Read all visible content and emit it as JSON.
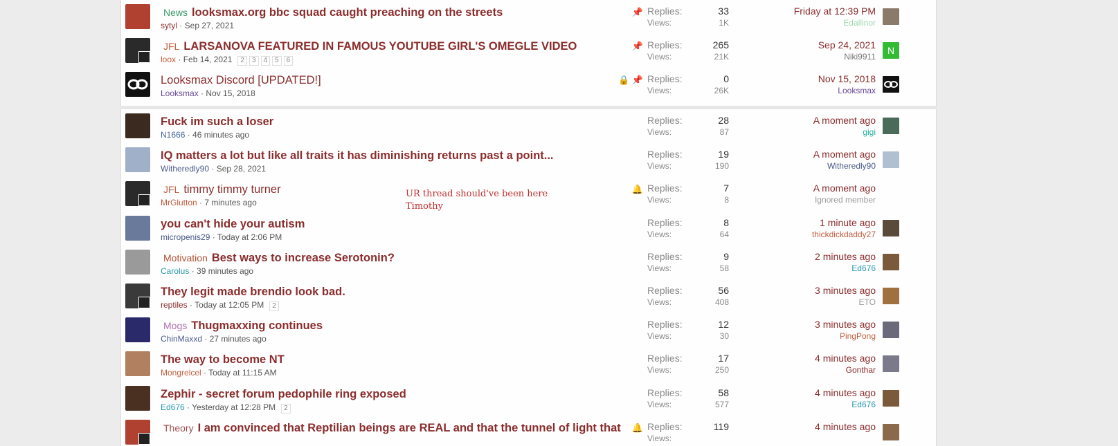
{
  "colors": {
    "title": "#8b2d2d",
    "background": "#ececec",
    "panel": "#fefefe"
  },
  "sticky_threads": [
    {
      "prefix": "News",
      "prefix_class": "p-news",
      "title": "looksmax.org bbc squad caught preaching on the streets",
      "author": "sytyl",
      "author_color": "#8b2d2d",
      "date": "Sep 27, 2021",
      "pages": [],
      "icons": "📌",
      "replies": "33",
      "views": "1K",
      "last_time": "Friday at 12:39 PM",
      "last_user": "Edallinor",
      "last_user_color": "#9fd9b0",
      "avatar_color": "#b04030",
      "avatar_mini": false,
      "last_avatar_color": "#8a7a6a"
    },
    {
      "prefix": "JFL",
      "prefix_class": "p-jfl",
      "title": "LARSANOVA FEATURED IN FAMOUS YOUTUBE GIRL'S OMEGLE VIDEO",
      "author": "loox",
      "author_color": "#c06040",
      "date": "Feb 14, 2021",
      "pages": [
        "2",
        "3",
        "4",
        "5",
        "6"
      ],
      "icons": "📌",
      "replies": "265",
      "views": "21K",
      "last_time": "Sep 24, 2021",
      "last_user": "Niki9911",
      "last_user_color": "#777777",
      "avatar_color": "#2a2a2a",
      "avatar_mini": true,
      "last_avatar_color": "#33bb33",
      "last_avatar_letter": "N"
    },
    {
      "prefix": "",
      "prefix_class": "",
      "title": "Looksmax Discord [UPDATED!]",
      "light": true,
      "author": "Looksmax",
      "author_color": "#6a4a9a",
      "date": "Nov 15, 2018",
      "pages": [],
      "icons": "🔒 📌",
      "replies": "0",
      "views": "26K",
      "last_time": "Nov 15, 2018",
      "last_user": "Looksmax",
      "last_user_color": "#6a4a9a",
      "avatar_color": "#111111",
      "avatar_mini": false,
      "last_avatar_color": "#111111",
      "avatar_logo": true
    }
  ],
  "threads": [
    {
      "prefix": "",
      "title": "Fuck im such a loser",
      "author": "N1666",
      "author_color": "#4a6a9a",
      "date": "46 minutes ago",
      "pages": [],
      "icons": "",
      "replies": "28",
      "views": "87",
      "last_time": "A moment ago",
      "last_user": "gigi",
      "last_user_color": "#22b0a0",
      "avatar_color": "#3a2a20",
      "avatar_mini": false,
      "last_avatar_color": "#4a6a5a"
    },
    {
      "prefix": "",
      "title": "IQ matters a lot but like all traits it has diminishing returns past a point...",
      "author": "Witheredly90",
      "author_color": "#4a5a8a",
      "date": "Sep 28, 2021",
      "pages": [],
      "icons": "",
      "replies": "19",
      "views": "190",
      "last_time": "A moment ago",
      "last_user": "Witheredly90",
      "last_user_color": "#4a5a8a",
      "avatar_color": "#a0b0c8",
      "avatar_mini": false,
      "last_avatar_color": "#b0c0d0"
    },
    {
      "prefix": "JFL",
      "prefix_class": "p-jfl",
      "title": "timmy timmy turner",
      "light": true,
      "author": "MrGlutton",
      "author_color": "#c06040",
      "date": "7 minutes ago",
      "pages": [],
      "icons": "🔔",
      "replies": "7",
      "views": "8",
      "last_time": "A moment ago",
      "last_user": "Ignored member",
      "last_user_color": "#999999",
      "avatar_color": "#2a2a2a",
      "avatar_mini": true,
      "last_avatar_color": "#fefefe"
    },
    {
      "prefix": "",
      "title": "you can't hide your autism",
      "author": "micropenis29",
      "author_color": "#4a5a8a",
      "date": "Today at 2:06 PM",
      "pages": [],
      "icons": "",
      "replies": "8",
      "views": "64",
      "last_time": "1 minute ago",
      "last_user": "thickdickdaddy27",
      "last_user_color": "#c06040",
      "avatar_color": "#6a7a9a",
      "avatar_mini": false,
      "last_avatar_color": "#5a4a3a"
    },
    {
      "prefix": "Motivation",
      "prefix_class": "p-mot",
      "title": "Best ways to increase Serotonin?",
      "author": "Carolus",
      "author_color": "#2a9ab0",
      "date": "39 minutes ago",
      "pages": [],
      "icons": "",
      "replies": "9",
      "views": "58",
      "last_time": "2 minutes ago",
      "last_user": "Ed676",
      "last_user_color": "#2a9ab0",
      "avatar_color": "#9a9a9a",
      "avatar_mini": false,
      "last_avatar_color": "#7a5a3a"
    },
    {
      "prefix": "",
      "title": "They legit made brendio look bad.",
      "author": "reptiles",
      "author_color": "#8b2d2d",
      "date": "Today at 12:05 PM",
      "pages": [
        "2"
      ],
      "icons": "",
      "replies": "56",
      "views": "408",
      "last_time": "3 minutes ago",
      "last_user": "ETO",
      "last_user_color": "#999999",
      "avatar_color": "#3a3a3a",
      "avatar_mini": true,
      "last_avatar_color": "#a07040"
    },
    {
      "prefix": "Mogs",
      "prefix_class": "p-mogs",
      "title": "Thugmaxxing continues",
      "author": "ChinMaxxd",
      "author_color": "#4a5a8a",
      "date": "27 minutes ago",
      "pages": [],
      "icons": "",
      "replies": "12",
      "views": "30",
      "last_time": "3 minutes ago",
      "last_user": "PingPong",
      "last_user_color": "#c06040",
      "avatar_color": "#2a2a6a",
      "avatar_mini": false,
      "last_avatar_color": "#6a6a7a"
    },
    {
      "prefix": "",
      "title": "The way to become NT",
      "author": "Mongrelcel",
      "author_color": "#c06040",
      "date": "Today at 11:15 AM",
      "pages": [],
      "icons": "",
      "replies": "17",
      "views": "250",
      "last_time": "4 minutes ago",
      "last_user": "Gonthar",
      "last_user_color": "#8b2d2d",
      "avatar_color": "#b08060",
      "avatar_mini": false,
      "last_avatar_color": "#7a7a8a"
    },
    {
      "prefix": "",
      "title": "Zephir - secret forum pedophile ring exposed",
      "author": "Ed676",
      "author_color": "#2a9ab0",
      "date": "Yesterday at 12:28 PM",
      "pages": [
        "2"
      ],
      "icons": "",
      "replies": "58",
      "views": "577",
      "last_time": "4 minutes ago",
      "last_user": "Ed676",
      "last_user_color": "#2a9ab0",
      "avatar_color": "#4a3020",
      "avatar_mini": false,
      "last_avatar_color": "#7a5a3a"
    },
    {
      "prefix": "Theory",
      "prefix_class": "p-theory",
      "title": "I am convinced that Reptilian beings are REAL and that the tunnel of light that",
      "author": "",
      "author_color": "#8b2d2d",
      "date": "",
      "pages": [],
      "icons": "🔔",
      "replies": "119",
      "views": "",
      "last_time": "4 minutes ago",
      "last_user": "",
      "last_user_color": "#2a9ab0",
      "avatar_color": "#b04030",
      "avatar_mini": true,
      "last_avatar_color": "#8a6a4a"
    }
  ],
  "labels": {
    "replies": "Replies:",
    "views": "Views:"
  },
  "note": {
    "line1": "UR thread should've been here",
    "line2": "Timothy"
  }
}
